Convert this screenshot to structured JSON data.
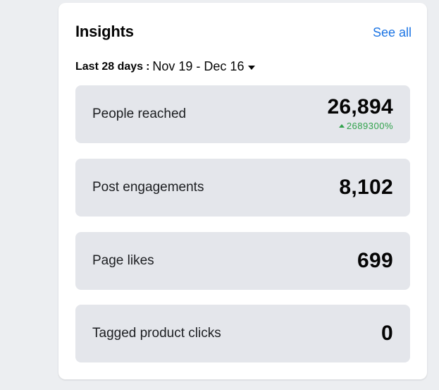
{
  "insights": {
    "title": "Insights",
    "see_all_label": "See all",
    "date_range": {
      "label": "Last 28 days",
      "separator": ":",
      "value": "Nov 19 - Dec 16"
    },
    "metrics": [
      {
        "label": "People reached",
        "value": "26,894",
        "change": "2689300%",
        "change_direction": "up"
      },
      {
        "label": "Post engagements",
        "value": "8,102"
      },
      {
        "label": "Page likes",
        "value": "699"
      },
      {
        "label": "Tagged product clicks",
        "value": "0"
      }
    ],
    "colors": {
      "accent": "#1b74e4",
      "positive": "#31a24c",
      "tile_background": "#e4e6eb"
    },
    "icons": {
      "dropdown": "caret-down-icon",
      "trend": "arrow-up-icon"
    }
  }
}
